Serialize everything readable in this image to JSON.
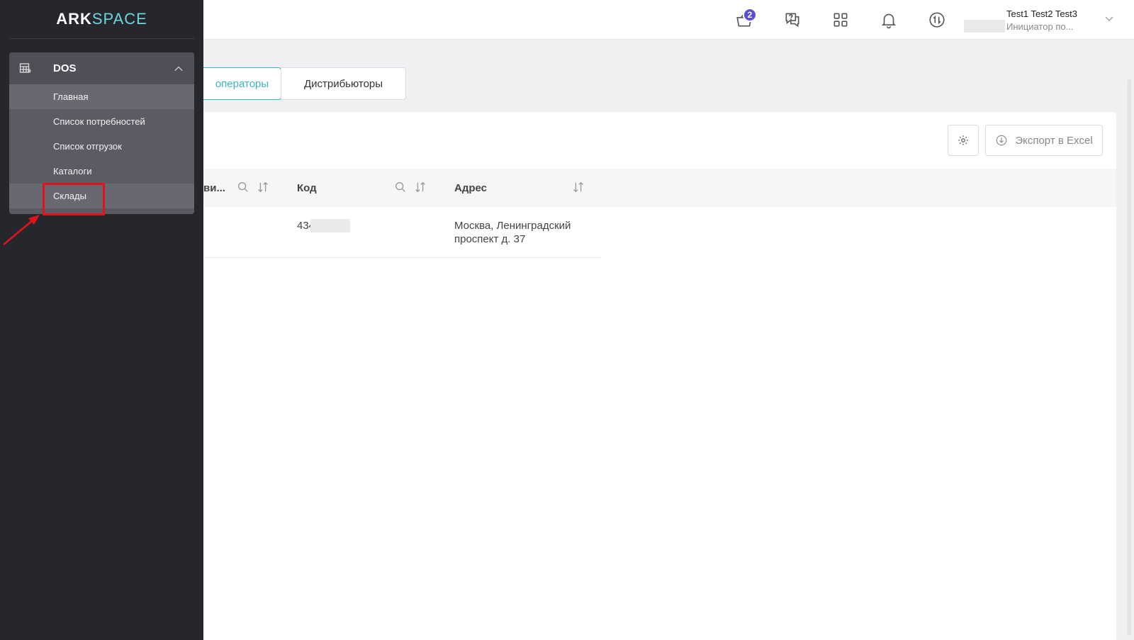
{
  "brand": {
    "part1": "ARK",
    "part2": "SPACE"
  },
  "sidebar": {
    "section_title": "DOS",
    "items": [
      {
        "label": "Главная"
      },
      {
        "label": "Список потребностей"
      },
      {
        "label": "Список отгрузок"
      },
      {
        "label": "Каталоги"
      },
      {
        "label": "Склады"
      }
    ]
  },
  "header": {
    "cart_count": "2",
    "user_name": "Test1 Test2 Test3",
    "user_role": "Инициатор по..."
  },
  "tabs": [
    {
      "label": "операторы",
      "active": true
    },
    {
      "label": "Дистрибьюторы",
      "active": false
    }
  ],
  "toolbar": {
    "export_label": "Экспорт в Excel"
  },
  "table": {
    "columns": [
      {
        "label": "ви..."
      },
      {
        "label": "Код"
      },
      {
        "label": "Адрес"
      }
    ],
    "rows": [
      {
        "code": "434",
        "address_line1": "Москва, Ленинградский",
        "address_line2": "проспект д. 37"
      }
    ]
  },
  "colors": {
    "accent": "#3bb5c2",
    "badge": "#5b4fd6",
    "highlight": "#e0131b",
    "sidebar": "#26272d"
  }
}
